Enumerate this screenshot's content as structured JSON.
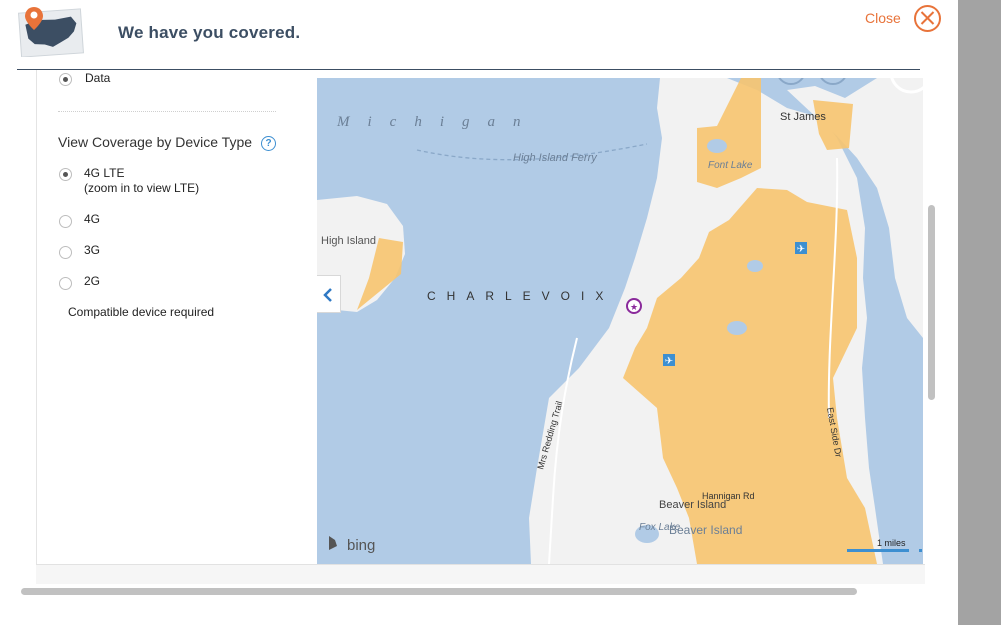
{
  "header": {
    "title": "We have you covered.",
    "close_label": "Close"
  },
  "panel": {
    "data_option_label": "Data",
    "section_title": "View Coverage by Device Type",
    "help_glyph": "?",
    "device_types": [
      {
        "label": "4G LTE",
        "sublabel": "(zoom in to view LTE)",
        "selected": true
      },
      {
        "label": "4G",
        "selected": false
      },
      {
        "label": "3G",
        "selected": false
      },
      {
        "label": "2G",
        "selected": false
      }
    ],
    "note": "Compatible device required"
  },
  "map": {
    "provider": "bing",
    "scale_label": "1 miles",
    "colors": {
      "water": "#b1cbe6",
      "land": "#f2f2f2",
      "coverage": "#f7c46f",
      "accent": "#e8733a"
    },
    "labels": {
      "lake": "Michigan",
      "region": "CHARLEVOIX",
      "ferry": "High Island Ferry",
      "high_island": "High Island",
      "st_james": "St James",
      "font_lake": "Font Lake",
      "beaver_island": "Beaver Island",
      "beaver_island_water": "Beaver Island",
      "fox_lake": "Fox Lake",
      "east_side_dr": "East Side Dr",
      "hannigan_rd": "Hannigan Rd",
      "mrs_redding_trail": "Mrs Redding Trail"
    }
  },
  "icons": [
    "map-pin-usa-logo",
    "close-circle-icon",
    "help-icon",
    "chevron-left-icon",
    "airport-icon",
    "bing-logo-icon"
  ]
}
